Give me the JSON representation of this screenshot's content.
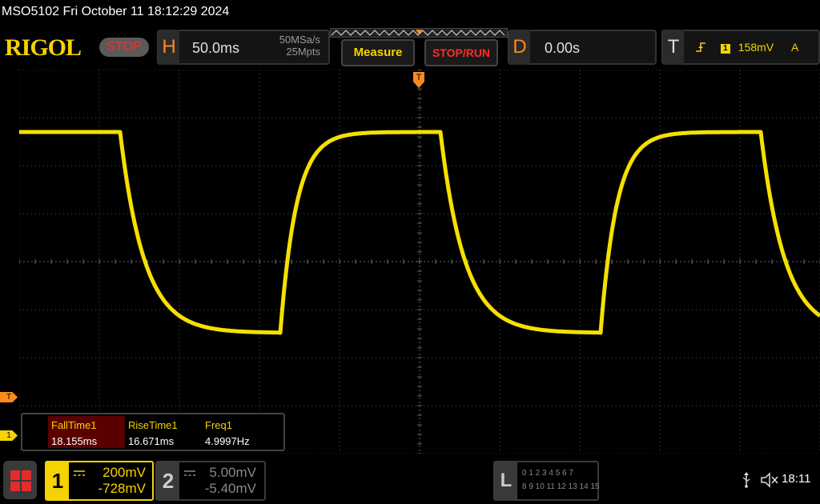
{
  "header": {
    "title": "MSO5102  Fri October 11 18:12:29 2024"
  },
  "topbar": {
    "logo": "RIGOL",
    "status": "STOP",
    "horizontal": {
      "letter": "H",
      "timebase": "50.0ms",
      "sample_rate": "50MSa/s",
      "memory_depth": "25Mpts"
    },
    "measure_label": "Measure",
    "stop_run_label": "STOP/RUN",
    "delay": {
      "letter": "D",
      "value": "0.00s"
    },
    "trigger": {
      "letter": "T",
      "source": "1",
      "level": "158mV",
      "mode": "A"
    }
  },
  "markers": {
    "trigger_position": "T",
    "trigger_level": "T",
    "ch1_offset": "1"
  },
  "measurements": [
    {
      "label": "FallTime1",
      "value": "18.155ms",
      "selected": true
    },
    {
      "label": "RiseTime1",
      "value": "16.671ms",
      "selected": false
    },
    {
      "label": "Freq1",
      "value": "4.9997Hz",
      "selected": false
    }
  ],
  "channels": [
    {
      "number": "1",
      "scale": "200mV",
      "offset": "-728mV",
      "color": "#f5d300",
      "active": true
    },
    {
      "number": "2",
      "scale": "5.00mV",
      "offset": "-5.40mV",
      "color": "#888888",
      "active": false
    }
  ],
  "logic": {
    "letter": "L",
    "row1": "0 1 2 3   4 5 6 7",
    "row2": "8 9 10 11  12 13 14 15"
  },
  "icons": {
    "menu": "menu-grid-icon",
    "usb": "usb-icon",
    "sound": "speaker-muted-icon"
  },
  "status_bar": {
    "time": "18:11"
  },
  "colors": {
    "ch1": "#f5d300",
    "trigger": "#ff8a1c",
    "stop": "#ff2b2b"
  }
}
